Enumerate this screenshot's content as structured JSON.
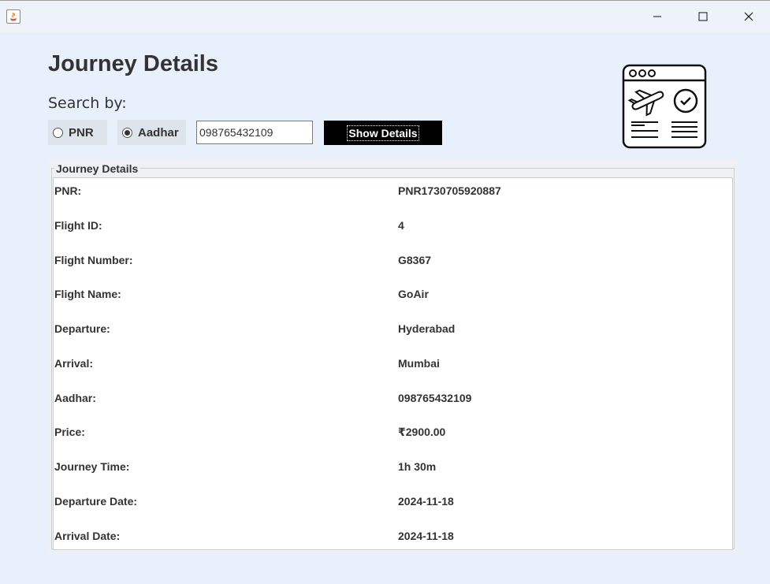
{
  "window": {
    "controls": {
      "minimize_icon": "minimize-icon",
      "maximize_icon": "maximize-icon",
      "close_icon": "close-icon"
    }
  },
  "header": {
    "title": "Journey Details",
    "search_by_label": "Search by:",
    "radio_pnr": "PNR",
    "radio_aadhar": "Aadhar",
    "selected": "Aadhar",
    "search_value": "098765432109",
    "show_button": "Show Details"
  },
  "panel": {
    "title": "Journey Details",
    "rows": [
      {
        "label": "PNR:",
        "value": "PNR1730705920887"
      },
      {
        "label": "Flight ID:",
        "value": "4"
      },
      {
        "label": "Flight Number:",
        "value": "G8367"
      },
      {
        "label": "Flight Name:",
        "value": "GoAir"
      },
      {
        "label": "Departure:",
        "value": "Hyderabad"
      },
      {
        "label": "Arrival:",
        "value": "Mumbai"
      },
      {
        "label": "Aadhar:",
        "value": "098765432109"
      },
      {
        "label": "Price:",
        "value": "₹2900.00"
      },
      {
        "label": "Journey Time:",
        "value": "1h 30m"
      },
      {
        "label": "Departure Date:",
        "value": "2024-11-18"
      },
      {
        "label": "Arrival Date:",
        "value": "2024-11-18"
      }
    ]
  },
  "colors": {
    "background": "#e8f1fb",
    "button_bg": "#000000",
    "button_text": "#ffffff",
    "text": "#333333"
  }
}
